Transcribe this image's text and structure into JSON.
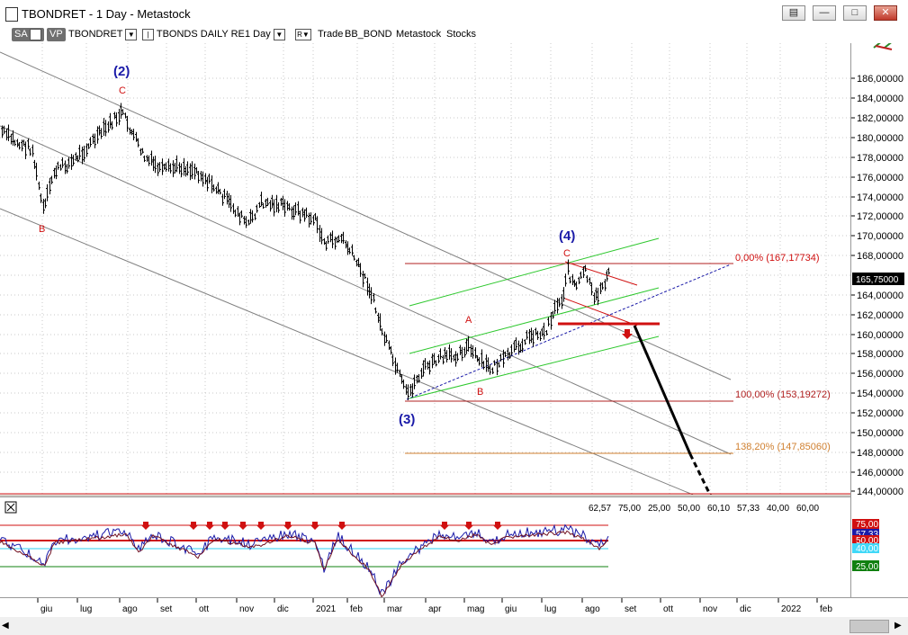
{
  "window": {
    "title": "TBONDRET - 1 Day - Metastock",
    "controls": [
      "restore",
      "minimize",
      "maximize",
      "close"
    ]
  },
  "toolbar": {
    "sa": "SA",
    "vp": "VP",
    "symbol": "TBONDRET",
    "description": "TBONDS DAILY RE",
    "period": "1 Day",
    "r_label": "R",
    "trade": "Trade",
    "bb_bond": "BB_BOND",
    "metastock": "Metastock",
    "stocks": "Stocks"
  },
  "wave_labels": {
    "w2": "(2)",
    "w3": "(3)",
    "w4": "(4)",
    "c1": "C",
    "c2": "C",
    "b1": "B",
    "a1": "A",
    "b2": "B"
  },
  "fib": {
    "f0": "0,00% (167,17734)",
    "f100": "100,00% (153,19272)",
    "f138": "138,20% (147,85060)"
  },
  "price_axis": {
    "labels": [
      "186,00000",
      "184,00000",
      "182,00000",
      "180,00000",
      "178,00000",
      "176,00000",
      "174,00000",
      "172,00000",
      "170,00000",
      "168,00000",
      "164,00000",
      "162,00000",
      "160,00000",
      "158,00000",
      "156,00000",
      "154,00000",
      "152,00000",
      "150,00000",
      "148,00000",
      "146,00000",
      "144,00000"
    ],
    "current": "165,75000"
  },
  "indicator": {
    "values": {
      "v1": "62,57",
      "v2": "75,00",
      "v3": "25,00",
      "v4": "50,00",
      "v5": "60,10",
      "v6": "57,33",
      "v7": "40,00",
      "v8": "60,00"
    },
    "axis_tags": {
      "t75": "75,00",
      "t57": "57,33",
      "t50": "50,00",
      "t40": "40,00",
      "t25": "25,00"
    }
  },
  "time_axis": {
    "labels": [
      "giu",
      "lug",
      "ago",
      "set",
      "ott",
      "nov",
      "dic",
      "2021",
      "feb",
      "mar",
      "apr",
      "mag",
      "giu",
      "lug",
      "ago",
      "set",
      "ott",
      "nov",
      "dic",
      "2022",
      "feb"
    ]
  },
  "colors": {
    "price": "#000000",
    "wave_blue": "#1a1aa8",
    "wave_red": "#d01010",
    "channel_green": "#2ec82e",
    "fib_red": "#b02020",
    "fib_orange": "#d08030",
    "projection": "#000000"
  }
}
